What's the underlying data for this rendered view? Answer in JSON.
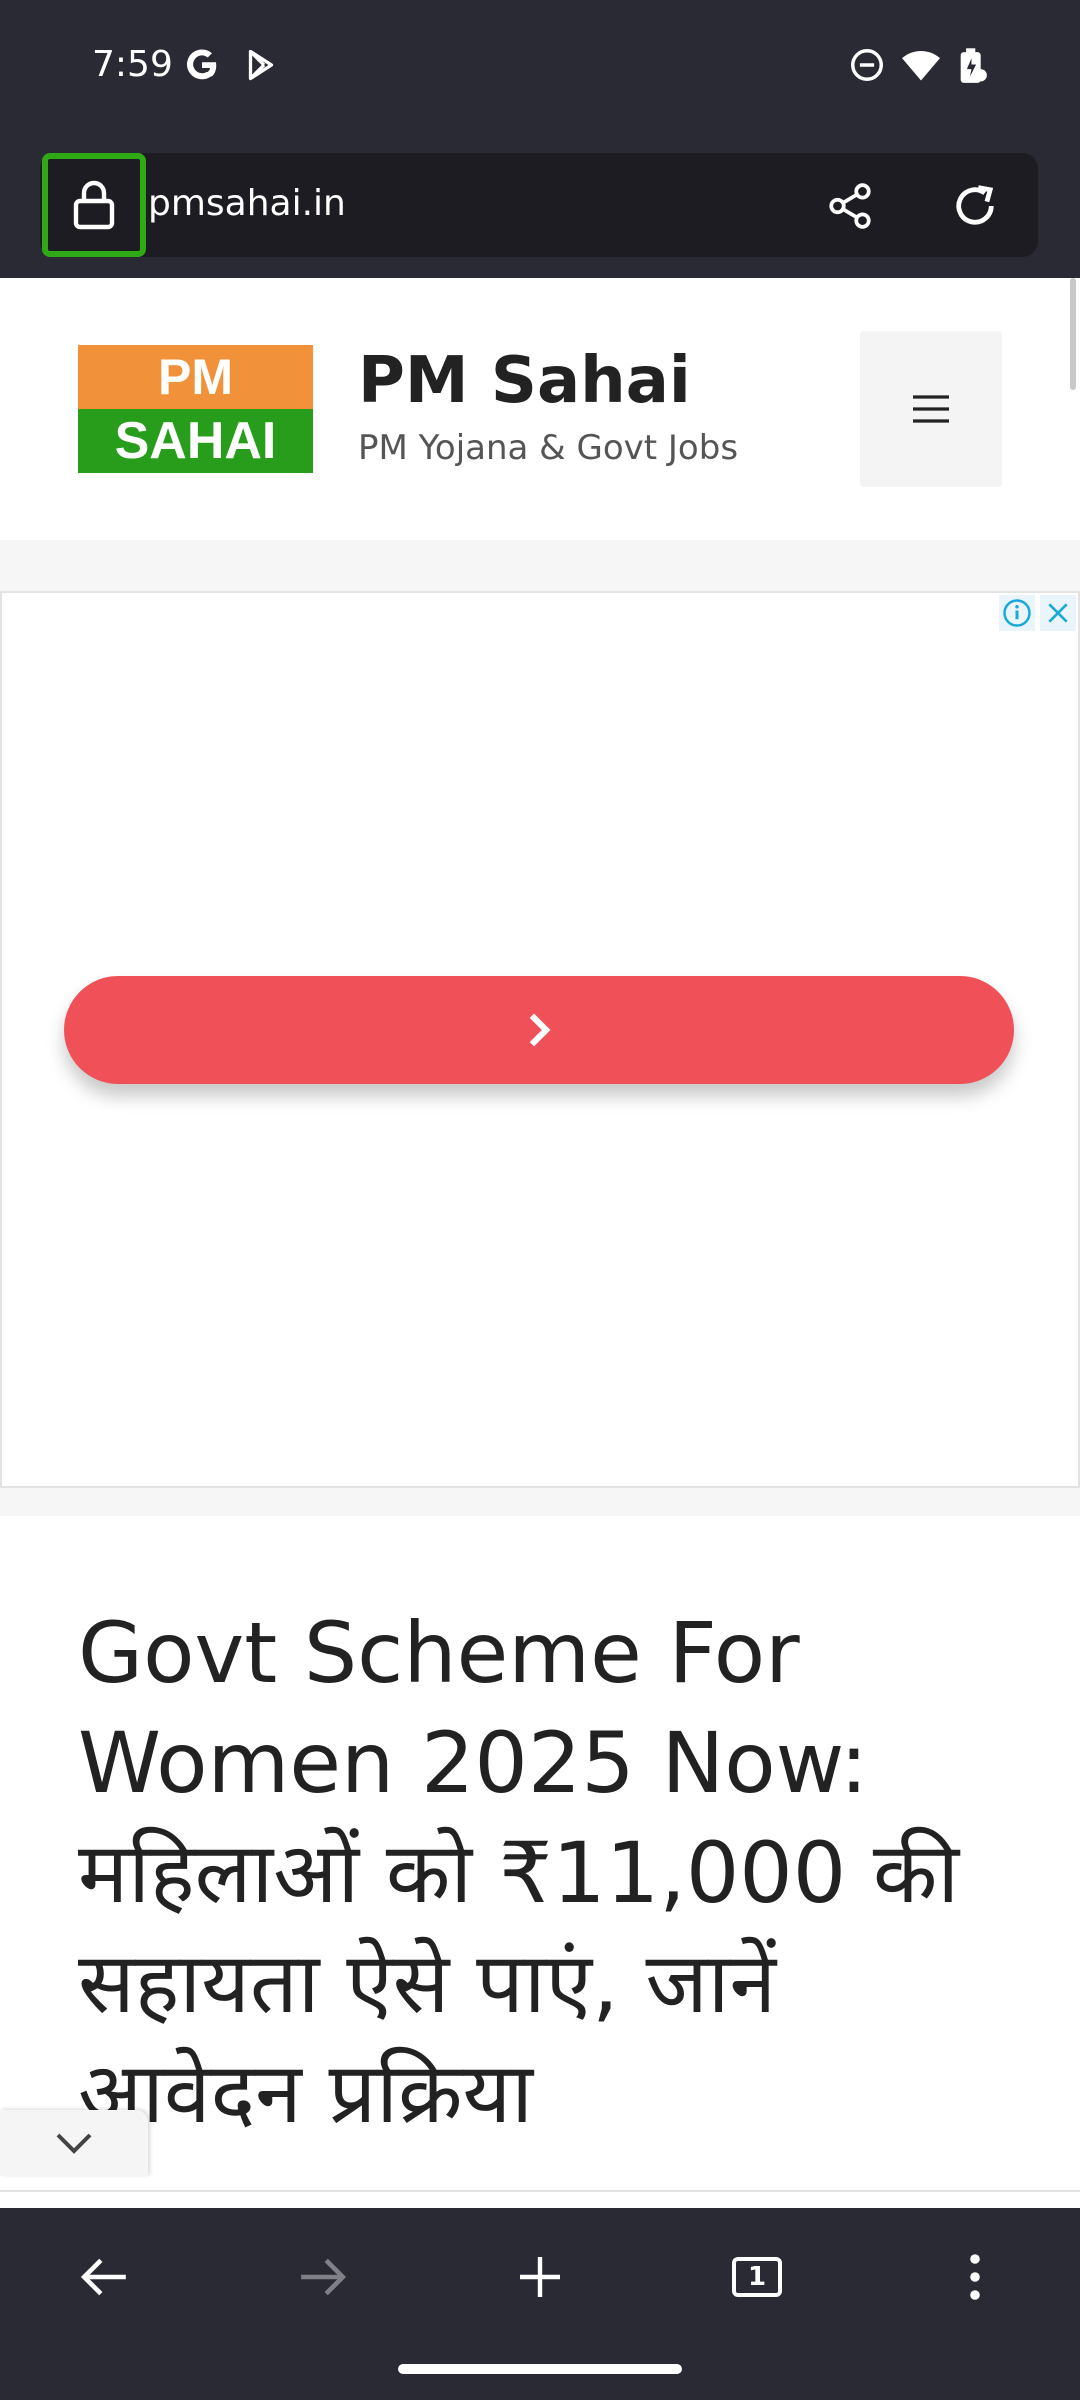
{
  "status_bar": {
    "time": "7:59",
    "left_icons": [
      "google-icon",
      "play-store-icon"
    ],
    "right_icons": [
      "dnd-icon",
      "wifi-icon",
      "battery-charging-icon"
    ]
  },
  "browser": {
    "url": "pmsahai.in",
    "icons": [
      "lock-icon",
      "share-icon",
      "reload-icon"
    ],
    "tab_count": "1"
  },
  "site": {
    "logo_top": "PM",
    "logo_bottom": "SAHAI",
    "title": "PM Sahai",
    "tagline": "PM Yojana & Govt Jobs",
    "logo_colors": {
      "top": "#f1913a",
      "bottom": "#279d1b"
    }
  },
  "ad": {
    "cta_color": "#f05159",
    "icons": [
      "ad-info-icon",
      "ad-close-icon",
      "chevron-right-icon"
    ]
  },
  "article": {
    "title_lines": [
      "Govt Scheme For",
      "Women 2025 Now:",
      "महिलाओं को ₹11,000 की",
      "सहायता ऐसे पाएं, जानें",
      "आवेदन प्रक्रिया"
    ]
  },
  "toolbar": {
    "icons": [
      "back-icon",
      "forward-icon",
      "new-tab-icon",
      "tab-switcher-icon",
      "more-icon"
    ]
  }
}
